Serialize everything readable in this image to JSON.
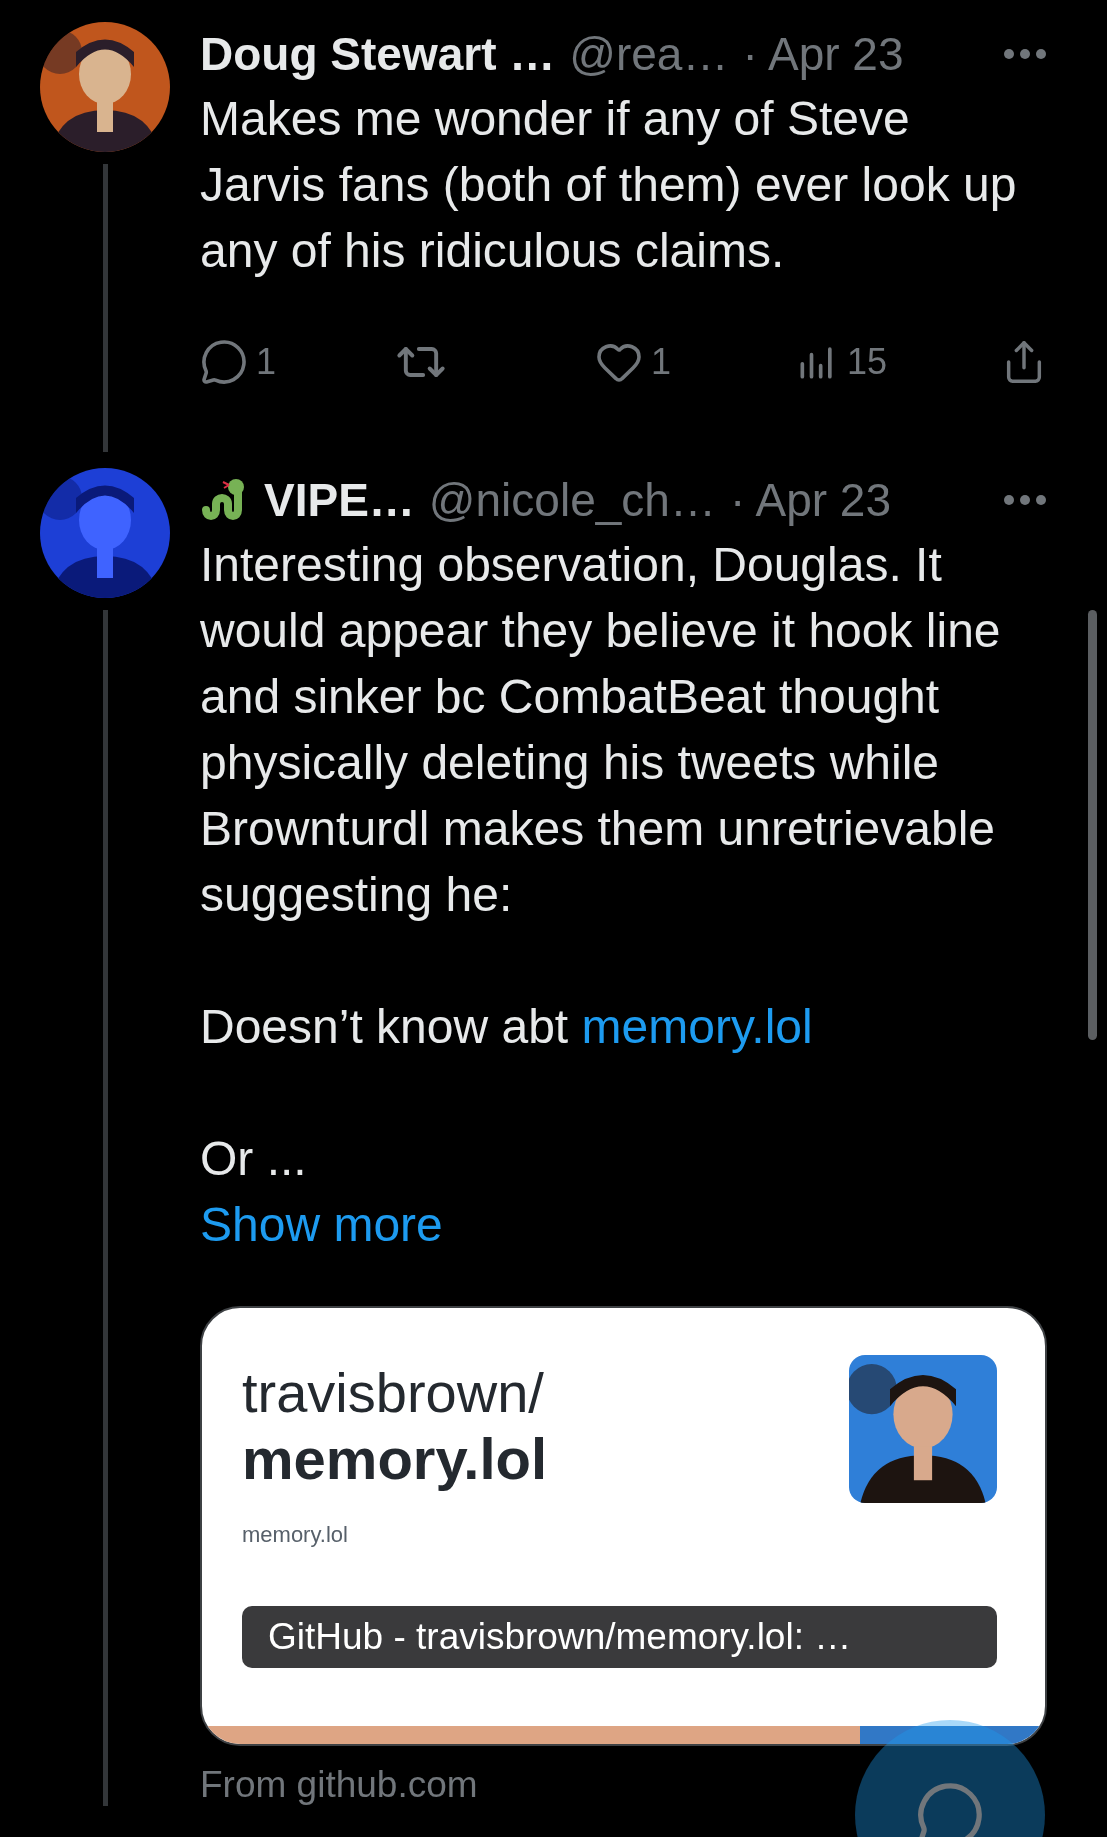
{
  "tweets": [
    {
      "author": "Doug Stewart …",
      "handle": "@rea…",
      "time": "· Apr 23",
      "emoji_badge": false,
      "paragraphs": [
        {
          "text": "Makes me wonder if any of Steve Jarvis fans (both of them) ever look up any of his ridiculous claims."
        }
      ],
      "actions": [
        {
          "kind": "reply",
          "count": "1"
        },
        {
          "kind": "repost"
        },
        {
          "kind": "like",
          "count": "1"
        },
        {
          "kind": "views",
          "count": "15"
        },
        {
          "kind": "share"
        }
      ]
    },
    {
      "author": "VIPE…",
      "handle": "@nicole_ch…",
      "time": "· Apr 23",
      "emoji_badge": true,
      "paragraphs": [
        {
          "text": "Interesting observation, Douglas. It would appear they believe it hook line and sinker bc CombatBeat thought physically deleting his tweets while Brownturdl makes them unretrievable suggesting he:"
        },
        {
          "text": "Doesn’t know abt ",
          "link": "memory.lol"
        },
        {
          "text": "Or  ..."
        }
      ],
      "show_more": "Show more",
      "card": {
        "owner": "travisbrown/",
        "repo": "memory.lol",
        "site": "memory.lol",
        "title": "GitHub - travisbrown/memory.lol: …",
        "source": "From github.com"
      }
    }
  ]
}
